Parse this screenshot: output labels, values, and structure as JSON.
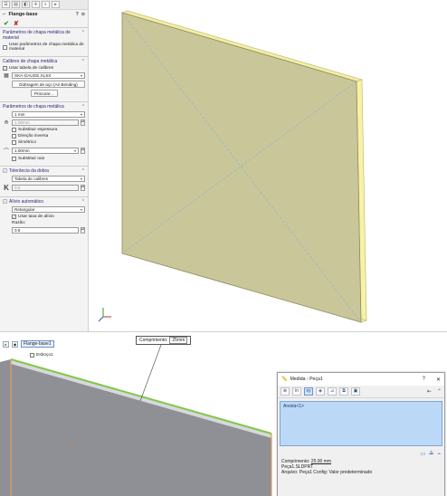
{
  "property_manager": {
    "tabs": [
      "feature-manager",
      "property-manager",
      "configuration-manager",
      "dimxpert",
      "display-manager"
    ],
    "title": "Flange-base",
    "groups": {
      "sheet_metal_params_material": {
        "header": "Parâmetros de chapa metálica de material",
        "use_material_label": "Usar parâmetros de chapa metálica de material"
      },
      "gauges": {
        "header": "Calibres de chapa metálica",
        "use_gauge_label": "Usar tabela de calibres",
        "gauge_file": "SKA-GAUGE.XLSX",
        "bend_table": "Dobragem de aço (Air Bending)",
        "browse": "Procurar..."
      },
      "sheet_metal_params": {
        "header": "Parâmetros de chapa metálica",
        "thickness_select": "1 mm",
        "thickness_value": "1.00mm",
        "override_thickness": "Substituir espessura",
        "reverse_direction": "Direção inversa",
        "symmetric": "Simétrico",
        "radius_value": "1.00mm",
        "override_radius": "Substituir raio"
      },
      "bend_allowance": {
        "header": "Tolerância da dobra",
        "type": "Tabela de calibres",
        "k_value": "0.5"
      },
      "auto_relief": {
        "header": "Alívio automático",
        "type": "Retangular",
        "use_ratio_label": "Usar taxa de alívio",
        "ratio_label": "Razão:",
        "ratio_value": "0.5"
      }
    }
  },
  "lower": {
    "tree_item": "Flange-base1",
    "sketch_item": "Esboço1",
    "callout_label": "Comprimento:",
    "callout_value": "25mm"
  },
  "measure": {
    "title": "Medida - Peça1",
    "help": "?",
    "close": "✕",
    "selection_item": "Aresta<1>",
    "length_label": "Comprimento:",
    "length_value": "25.00 mm",
    "part_line": "Peça1.SLDPRT",
    "file_line": "Arquivo: Peça1 Config: Valor predeterminado"
  },
  "colors": {
    "plate_face": "#c9c69a",
    "plate_edge": "#f4f0a0",
    "edge_highlight": "#7ec84a",
    "selection_bg": "#bcd8f7"
  }
}
